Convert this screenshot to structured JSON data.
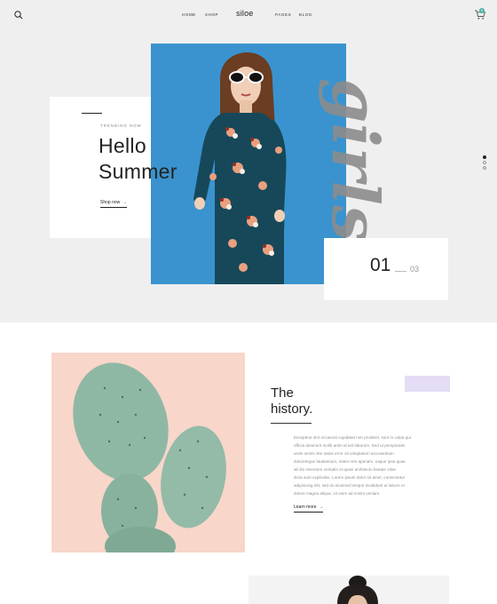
{
  "nav": {
    "logo": "siloe",
    "links": [
      "HOME",
      "SHOP",
      "PAGES",
      "BLOG"
    ],
    "cart_count": "0"
  },
  "hero": {
    "eyebrow": "TRENDING NOW",
    "title_line1": "Hello",
    "title_line2": "Summer",
    "cta": "Shop now",
    "script_word": "girls",
    "slide_current": "01",
    "slide_total": "03",
    "slider_dots": 3,
    "active_dot": 0
  },
  "history": {
    "title_line1": "The",
    "title_line2": "history.",
    "body_lines": [
      "Excepteur sint occaecat cupidatat non proident, sunt in culpa qui",
      "officia deserunt mollit anim id est laborum. Sed ut perspiciatis",
      "unde omnis iste natus error sit voluptatem accusantium",
      "doloremque laudantium, totam rem aperiam, eaque ipsa quae",
      "ab illo inventore veritatis et quasi architecto beatae vitae",
      "dicta sunt explicabo. Lorem ipsum dolor sit amet, consectetur",
      "adipisicing elit, sed do eiusmod tempor incididunt ut labore et",
      "dolore magna aliqua. Ut enim ad minim veniam."
    ],
    "cta": "Learn more"
  },
  "colors": {
    "hero_bg": "#efefef",
    "photo_blue": "#3a93cf",
    "peach": "#f8d6c9",
    "lavender": "#e5dcf5",
    "badge": "#4ab3a8"
  }
}
